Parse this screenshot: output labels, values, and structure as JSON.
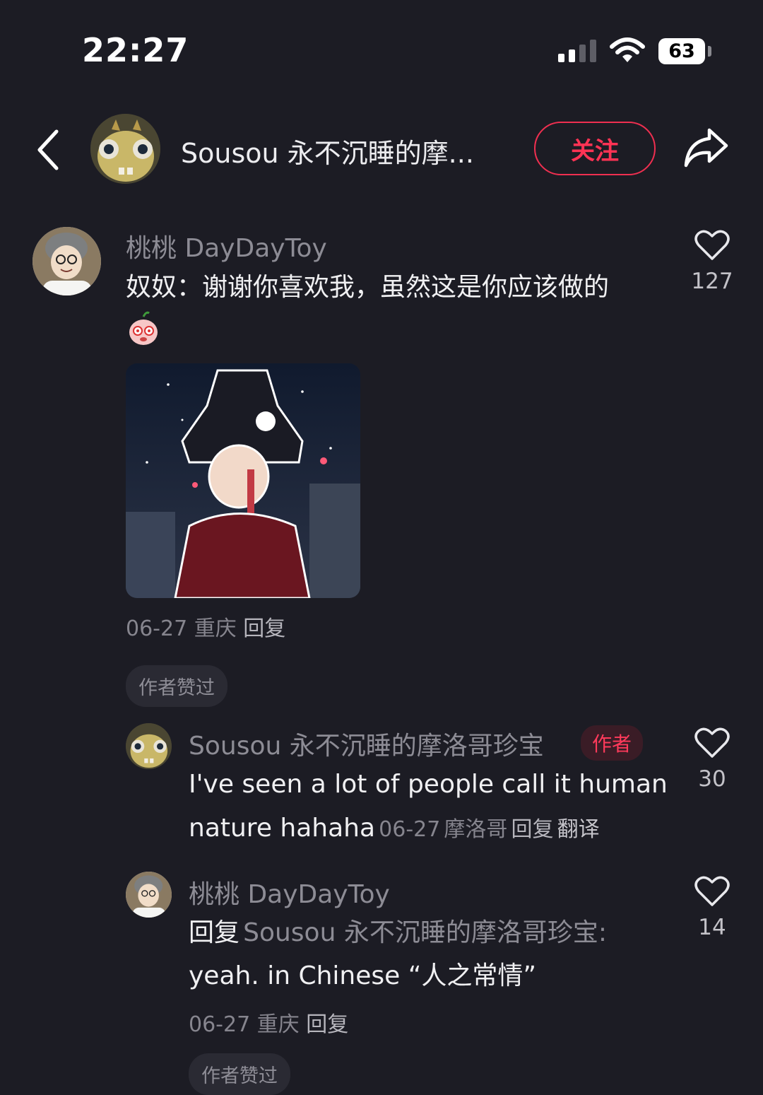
{
  "status_bar": {
    "time": "22:27",
    "battery": "63"
  },
  "header": {
    "title": "Sousou 永不沉睡的摩...",
    "follow_label": "关注"
  },
  "comments": [
    {
      "username": "桃桃 DayDayToy",
      "text": "奴奴：谢谢你喜欢我，虽然这是你应该做的",
      "likes": "127",
      "date": "06-27",
      "location": "重庆",
      "reply_label": "回复",
      "badge": "作者赞过"
    }
  ],
  "replies": [
    {
      "username": "Sousou 永不沉睡的摩洛哥珍宝",
      "author_tag": "作者",
      "text_line1": "I've seen a lot of people call it human",
      "text_line2": "nature hahaha",
      "likes": "30",
      "date": "06-27",
      "location": "摩洛哥",
      "reply_label": "回复",
      "translate_label": "翻译"
    },
    {
      "username": "桃桃 DayDayToy",
      "reply_prefix": "回复",
      "reply_to": "Sousou 永不沉睡的摩洛哥珍宝:",
      "text_line2": "yeah. in Chinese “人之常情”",
      "likes": "14",
      "date": "06-27",
      "location": "重庆",
      "reply_label": "回复",
      "badge": "作者赞过"
    }
  ],
  "colors": {
    "background": "#1c1c24",
    "accent": "#ff3354"
  }
}
